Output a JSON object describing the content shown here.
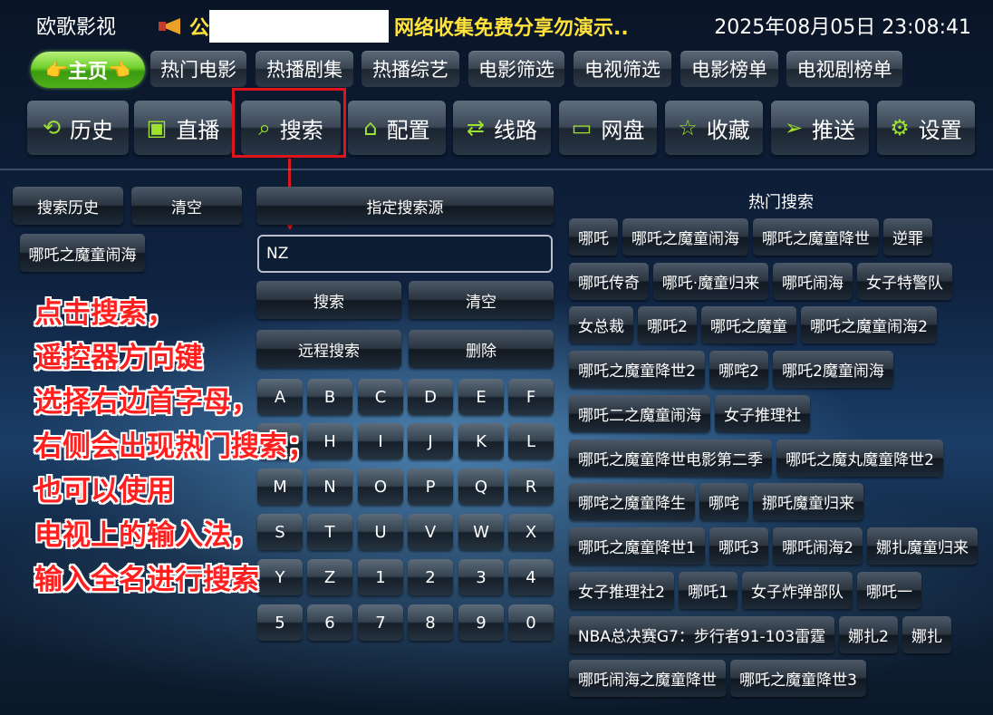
{
  "header": {
    "app_title": "欧歌影视",
    "notice_prefix": "公",
    "notice_text": "网络收集免费分享勿演示..",
    "clock": "2025年08月05日 23:08:41"
  },
  "tabs": {
    "home": "主页",
    "items": [
      "热门电影",
      "热播剧集",
      "热播综艺",
      "电影筛选",
      "电视筛选",
      "电影榜单",
      "电视剧榜单"
    ]
  },
  "nav": {
    "items": [
      {
        "label": "历史",
        "icon": "history-icon"
      },
      {
        "label": "直播",
        "icon": "tv-icon"
      },
      {
        "label": "搜索",
        "icon": "search-icon"
      },
      {
        "label": "配置",
        "icon": "home-config-icon"
      },
      {
        "label": "线路",
        "icon": "route-icon"
      },
      {
        "label": "网盘",
        "icon": "card-icon"
      },
      {
        "label": "收藏",
        "icon": "star-icon"
      },
      {
        "label": "推送",
        "icon": "send-icon"
      },
      {
        "label": "设置",
        "icon": "gear-icon"
      }
    ]
  },
  "left": {
    "history_btn": "搜索历史",
    "clear_btn": "清空",
    "history_items": [
      "哪吒之魔童闹海"
    ]
  },
  "search": {
    "source_btn": "指定搜索源",
    "input_value": "NZ",
    "search_btn": "搜索",
    "clear_btn": "清空",
    "remote_btn": "远程搜索",
    "delete_btn": "删除",
    "keys": [
      "A",
      "B",
      "C",
      "D",
      "E",
      "F",
      "G",
      "H",
      "I",
      "J",
      "K",
      "L",
      "M",
      "N",
      "O",
      "P",
      "Q",
      "R",
      "S",
      "T",
      "U",
      "V",
      "W",
      "X",
      "Y",
      "Z",
      "1",
      "2",
      "3",
      "4",
      "5",
      "6",
      "7",
      "8",
      "9",
      "0"
    ]
  },
  "hot": {
    "title": "热门搜索",
    "rows": [
      [
        "哪吒",
        "哪吒之魔童闹海",
        "哪吒之魔童降世",
        "逆罪"
      ],
      [
        "哪吒传奇",
        "哪吒·魔童归来",
        "哪吒闹海",
        "女子特警队"
      ],
      [
        "女总裁",
        "哪吒2",
        "哪吒之魔童",
        "哪吒之魔童闹海2"
      ],
      [
        "哪吒之魔童降世2",
        "哪咤2",
        "哪吒2魔童闹海"
      ],
      [
        "哪吒二之魔童闹海",
        "女子推理社"
      ],
      [
        "哪吒之魔童降世电影第二季",
        "哪吒之魔丸魔童降世2"
      ],
      [
        "哪咤之魔童降生",
        "哪咤",
        "挪吒魔童归来"
      ],
      [
        "哪吒之魔童降世1",
        "哪吒3",
        "哪吒闹海2",
        "娜扎魔童归来"
      ],
      [
        "女子推理社2",
        "哪吒1",
        "女子炸弹部队",
        "哪吒一"
      ],
      [
        "NBA总决赛G7：步行者91-103雷霆",
        "娜扎2",
        "娜扎"
      ],
      [
        "哪吒闹海之魔童降世",
        "哪吒之魔童降世3"
      ]
    ]
  },
  "annotation": [
    "点击搜索，",
    "遥控器方向键",
    "选择右边首字母，",
    "右侧会出现热门搜索；",
    "也可以使用",
    "电视上的输入法，",
    "输入全名进行搜索"
  ]
}
